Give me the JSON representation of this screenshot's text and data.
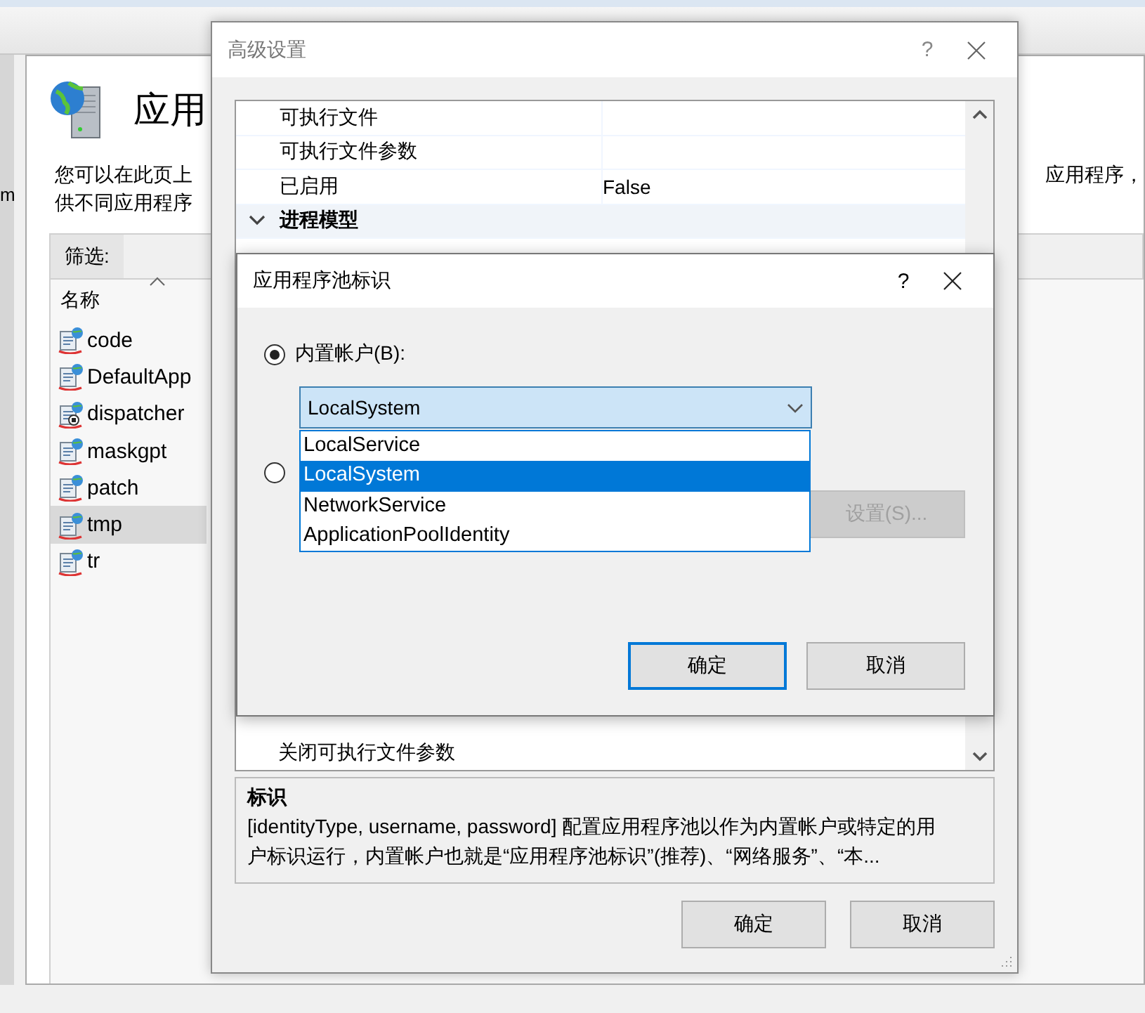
{
  "manager": {
    "edge_text": "m",
    "title": "应用",
    "description_lines": [
      "您可以在此页上",
      "供不同应用程序"
    ],
    "description_right": "应用程序，",
    "filter_label": "筛选:",
    "list_header": "名称",
    "app_pools": [
      {
        "name": "code",
        "kind": "started",
        "selected": false
      },
      {
        "name": "DefaultApp",
        "kind": "started",
        "selected": false
      },
      {
        "name": "dispatcher",
        "kind": "stopped",
        "selected": false
      },
      {
        "name": "maskgpt",
        "kind": "started",
        "selected": false
      },
      {
        "name": "patch",
        "kind": "started",
        "selected": false
      },
      {
        "name": "tmp",
        "kind": "started",
        "selected": true
      },
      {
        "name": "tr",
        "kind": "started",
        "selected": false
      }
    ]
  },
  "advanced_settings": {
    "title": "高级设置",
    "help_button": "?",
    "rows": [
      {
        "kind": "property",
        "name": "可执行文件"
      },
      {
        "kind": "property",
        "name": "可执行文件参数"
      },
      {
        "kind": "property",
        "name": "已启用",
        "value": "False"
      },
      {
        "kind": "category",
        "name": "进程模型",
        "expanded": true
      }
    ],
    "bottom_row": {
      "name": "关闭可执行文件参数"
    },
    "description": {
      "title": "标识",
      "text": "[identityType, username, password] 配置应用程序池以作为内置帐户或特定的用户标识运行，内置帐户也就是“应用程序池标识”(推荐)、“网络服务”、“本..."
    },
    "buttons": [
      "确定",
      "取消"
    ]
  },
  "identity_dialog": {
    "title": "应用程序池标识",
    "help_button": "?",
    "options": [
      {
        "kind": "builtin",
        "label": "内置帐户(B):",
        "selected": true
      },
      {
        "kind": "custom",
        "selected": false
      }
    ],
    "combo": {
      "value": "LocalSystem",
      "expanded": true,
      "items": [
        {
          "label": "LocalService",
          "selected": false
        },
        {
          "label": "LocalSystem",
          "selected": true
        },
        {
          "label": "NetworkService",
          "selected": false
        },
        {
          "label": "ApplicationPoolIdentity",
          "selected": false
        }
      ]
    },
    "set_button": {
      "label": "设置(S)...",
      "disabled": true
    },
    "buttons": [
      {
        "label": "确定",
        "default": true
      },
      {
        "label": "取消",
        "default": false
      }
    ]
  }
}
